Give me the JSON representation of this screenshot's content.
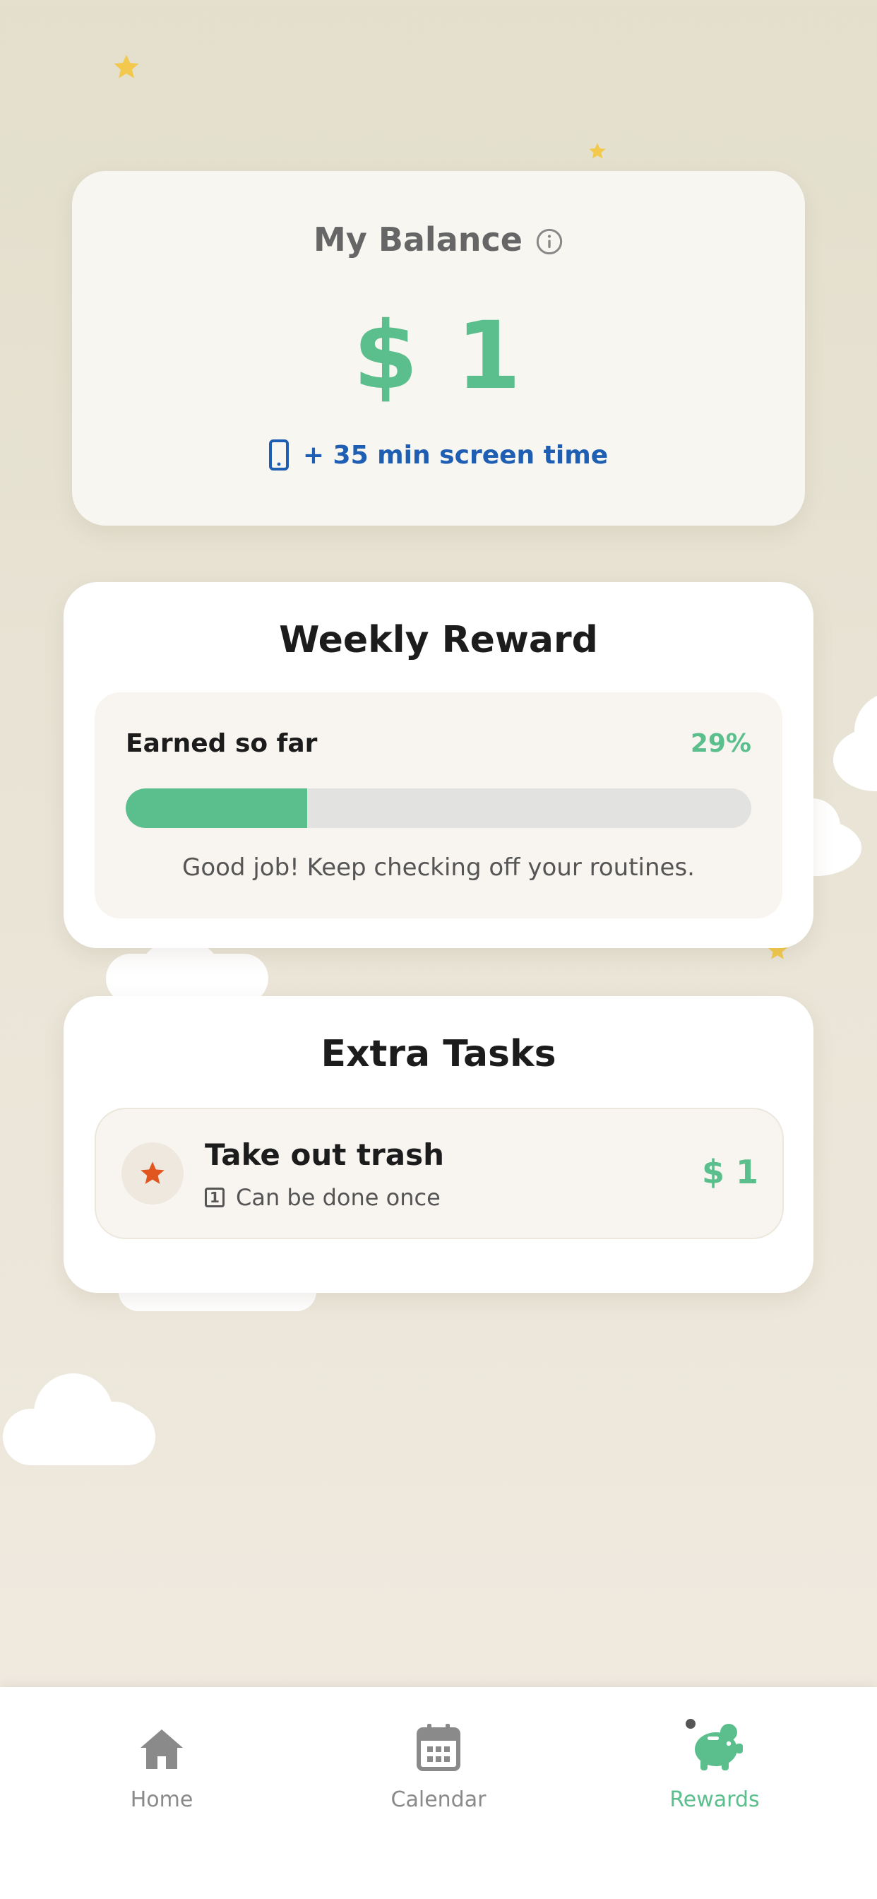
{
  "balance": {
    "title": "My Balance",
    "info_icon": "info-icon",
    "amount": "$ 1",
    "screen_time": "+ 35 min screen time",
    "screen_time_icon": "phone-icon"
  },
  "weekly_reward": {
    "title": "Weekly Reward",
    "earned_label": "Earned so far",
    "earned_percent_text": "29%",
    "progress_fraction": 0.29,
    "message": "Good job! Keep checking off your routines."
  },
  "extra_tasks": {
    "title": "Extra Tasks",
    "tasks": [
      {
        "icon": "star-icon",
        "title": "Take out trash",
        "subtitle": "Can be done once",
        "subtitle_icon_text": "1",
        "amount": "$ 1"
      }
    ]
  },
  "tabs": [
    {
      "label": "Home",
      "icon": "home-icon",
      "active": false
    },
    {
      "label": "Calendar",
      "icon": "calendar-icon",
      "active": false
    },
    {
      "label": "Rewards",
      "icon": "piggy-bank-icon",
      "active": true
    }
  ],
  "colors": {
    "accent_green": "#5bbf8d",
    "link_blue": "#1e5fb4",
    "star_orange": "#e0561e",
    "deco_star_yellow": "#f2c94c"
  }
}
